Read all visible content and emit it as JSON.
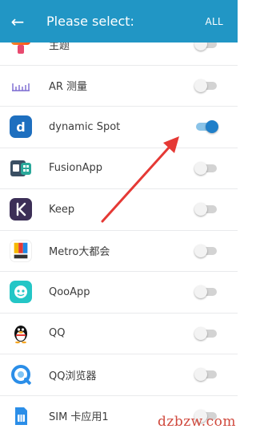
{
  "header": {
    "title": "Please select:",
    "all_label": "ALL",
    "bg_color": "#2196c5"
  },
  "apps": [
    {
      "label": "主题",
      "icon": "theme-brush-icon",
      "enabled": false
    },
    {
      "label": "AR 测量",
      "icon": "ar-ruler-icon",
      "enabled": false
    },
    {
      "label": "dynamic Spot",
      "icon": "dynamic-spot-icon",
      "enabled": true
    },
    {
      "label": "FusionApp",
      "icon": "fusionapp-icon",
      "enabled": false
    },
    {
      "label": "Keep",
      "icon": "keep-icon",
      "enabled": false
    },
    {
      "label": "Metro大都会",
      "icon": "metro-icon",
      "enabled": false
    },
    {
      "label": "QooApp",
      "icon": "qooapp-icon",
      "enabled": false
    },
    {
      "label": "QQ",
      "icon": "qq-penguin-icon",
      "enabled": false
    },
    {
      "label": "QQ浏览器",
      "icon": "qq-browser-icon",
      "enabled": false
    },
    {
      "label": "SIM 卡应用1",
      "icon": "sim-card-icon",
      "enabled": false
    }
  ],
  "watermark": "dzbzw.com",
  "colors": {
    "switch_on": "#1f7fc9",
    "arrow": "#e53935"
  }
}
